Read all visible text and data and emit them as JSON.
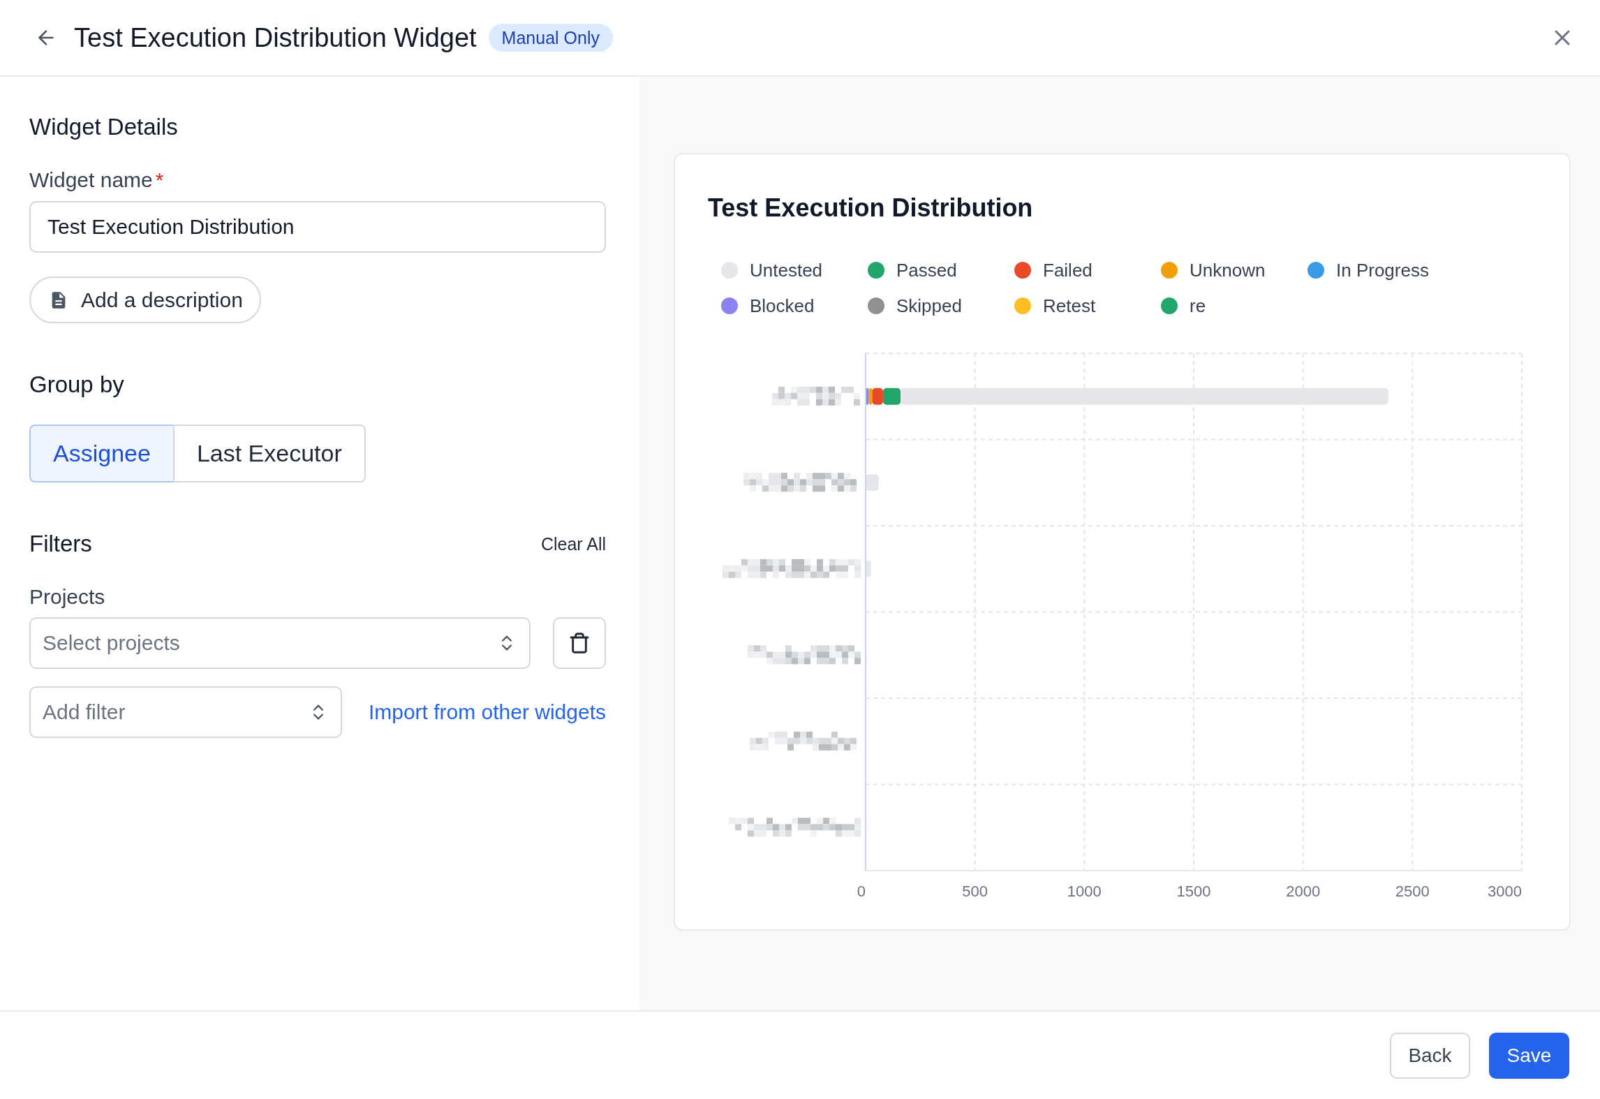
{
  "header": {
    "title": "Test Execution Distribution Widget",
    "badge": "Manual Only"
  },
  "details": {
    "heading": "Widget Details",
    "name_field": {
      "label": "Widget name",
      "required_mark": "*",
      "value": "Test Execution Distribution"
    },
    "description_button": "Add a description"
  },
  "group_by": {
    "heading": "Group by",
    "options": [
      {
        "label": "Assignee",
        "selected": true
      },
      {
        "label": "Last Executor",
        "selected": false
      }
    ]
  },
  "filters": {
    "heading": "Filters",
    "clear_all": "Clear All",
    "projects": {
      "label": "Projects",
      "placeholder": "Select projects"
    },
    "add_filter": {
      "placeholder": "Add filter"
    },
    "import_link": "Import from other widgets"
  },
  "preview": {
    "title": "Test Execution Distribution",
    "chart_data": {
      "type": "bar",
      "orientation": "horizontal",
      "stacked": true,
      "grid": true,
      "xlim": [
        0,
        3000
      ],
      "xticks": [
        0,
        500,
        1000,
        1500,
        2000,
        2500,
        3000
      ],
      "series": [
        {
          "name": "Untested",
          "color": "#e5e7eb",
          "values": [
            2230,
            60,
            25,
            0,
            0,
            0
          ]
        },
        {
          "name": "Passed",
          "color": "#22a56b",
          "values": [
            80,
            0,
            0,
            0,
            0,
            0
          ]
        },
        {
          "name": "Failed",
          "color": "#e84a27",
          "values": [
            50,
            0,
            0,
            0,
            0,
            0
          ]
        },
        {
          "name": "Unknown",
          "color": "#f59e0b",
          "values": [
            15,
            0,
            0,
            0,
            0,
            0
          ]
        },
        {
          "name": "In Progress",
          "color": "#3b9be6",
          "values": [
            0,
            0,
            0,
            0,
            0,
            0
          ]
        },
        {
          "name": "Blocked",
          "color": "#8b83f2",
          "values": [
            15,
            0,
            0,
            0,
            0,
            0
          ]
        },
        {
          "name": "Skipped",
          "color": "#909090",
          "values": [
            0,
            0,
            0,
            0,
            0,
            0
          ]
        },
        {
          "name": "Retest",
          "color": "#fbbf24",
          "values": [
            0,
            0,
            0,
            0,
            0,
            0
          ]
        },
        {
          "name": "re",
          "color": "#23a66c",
          "values": [
            0,
            0,
            0,
            0,
            0,
            0
          ]
        }
      ]
    }
  },
  "footer": {
    "buttons": [
      {
        "label": "Back",
        "kind": "secondary"
      },
      {
        "label": "Save",
        "kind": "primary"
      }
    ]
  }
}
